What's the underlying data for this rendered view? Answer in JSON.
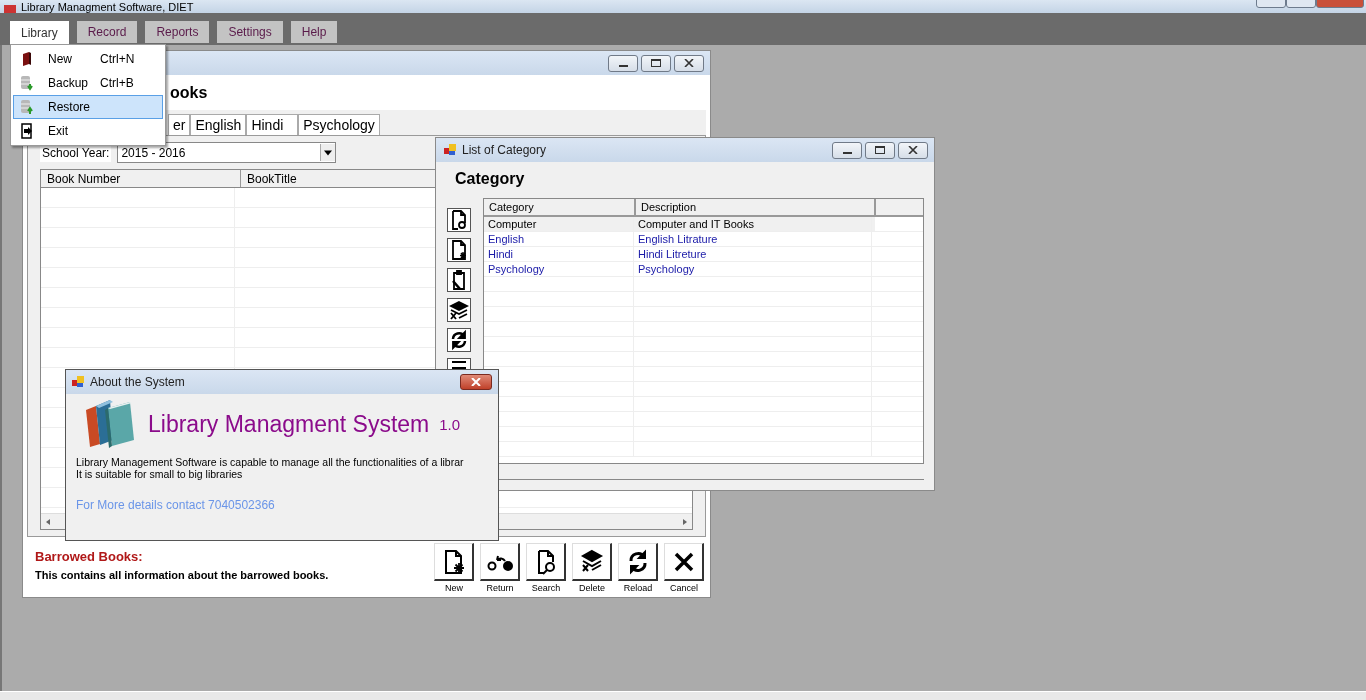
{
  "app": {
    "title": "Library Managment Software, DIET"
  },
  "menu_bar": [
    {
      "label": "Library",
      "selected": true
    },
    {
      "label": "Record",
      "selected": false
    },
    {
      "label": "Reports",
      "selected": false
    },
    {
      "label": "Settings",
      "selected": false
    },
    {
      "label": "Help",
      "selected": false
    }
  ],
  "menu_dropdown": [
    {
      "kind": "book",
      "label": "New",
      "shortcut": "Ctrl+N",
      "selected": false
    },
    {
      "kind": "backup",
      "label": "Backup",
      "shortcut": "Ctrl+B",
      "selected": false
    },
    {
      "kind": "restore",
      "label": "Restore",
      "selected": true
    },
    {
      "kind": "exit",
      "label": "Exit",
      "selected": false
    }
  ],
  "books_window": {
    "heading": "ooks",
    "tabs": [
      "er",
      "English",
      "Hindi",
      "Psychology"
    ],
    "school_year_label": "School Year:",
    "school_year": "2015 - 2016",
    "columns": [
      "Book Number",
      "BookTitle"
    ],
    "footer_title": "Barrowed Books:",
    "footer_text": "This contains all information about the barrowed books.",
    "buttons": [
      {
        "kind": "new",
        "label": "New"
      },
      {
        "kind": "return",
        "label": "Return"
      },
      {
        "kind": "search",
        "label": "Search"
      },
      {
        "kind": "delete",
        "label": "Delete"
      },
      {
        "kind": "reload",
        "label": "Reload"
      },
      {
        "kind": "cancel",
        "label": "Cancel"
      }
    ]
  },
  "category_window": {
    "title": "List of Category",
    "heading": "Category",
    "columns": [
      "Category",
      "Description"
    ],
    "rows": [
      {
        "category": "Computer",
        "description": "Computer and IT Books",
        "selected": true
      },
      {
        "category": "English",
        "description": "English Litrature",
        "selected": false
      },
      {
        "category": "Hindi",
        "description": "Hindi Litreture",
        "selected": false
      },
      {
        "category": "Psychology",
        "description": "Psychology",
        "selected": false
      }
    ]
  },
  "about_window": {
    "title": "About the System",
    "product": "Library Managment System",
    "version": "1.0",
    "description": [
      "Library Management Software is capable to manage all the functionalities of a librar",
      "It is suitable for small to big libraries"
    ],
    "contact": "For More details contact 7040502366"
  }
}
